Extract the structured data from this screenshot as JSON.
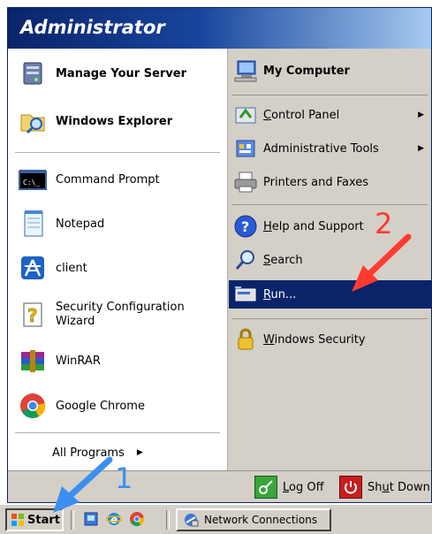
{
  "header": {
    "user": "Administrator"
  },
  "left_pinned": [
    {
      "label": "Manage Your Server",
      "icon": "server-icon"
    },
    {
      "label": "Windows Explorer",
      "icon": "folder-search-icon"
    }
  ],
  "left_recent": [
    {
      "label": "Command Prompt",
      "icon": "cmd-icon"
    },
    {
      "label": "Notepad",
      "icon": "notepad-icon"
    },
    {
      "label": "client",
      "icon": "client-icon"
    },
    {
      "label": "Security Configuration Wizard",
      "icon": "security-wizard-icon"
    },
    {
      "label": "WinRAR",
      "icon": "winrar-icon"
    },
    {
      "label": "Google Chrome",
      "icon": "chrome-icon"
    }
  ],
  "all_programs": "All Programs",
  "right_items": [
    {
      "label": "My Computer",
      "icon": "computer-icon"
    },
    {
      "label": "Control Panel",
      "icon": "control-panel-icon"
    },
    {
      "label": "Administrative Tools",
      "icon": "admin-tools-icon"
    },
    {
      "label": "Printers and Faxes",
      "icon": "printer-icon"
    },
    {
      "label": "Help and Support",
      "icon": "help-icon"
    },
    {
      "label": "Search",
      "icon": "search-icon"
    },
    {
      "label": "Run...",
      "icon": "run-icon"
    },
    {
      "label": "Windows Security",
      "icon": "lock-icon"
    }
  ],
  "bottom": {
    "logoff": "Log Off",
    "shutdown": "Shut Down"
  },
  "taskbar": {
    "start": "Start",
    "task": "Network Connections"
  },
  "annotations": {
    "step1": "1",
    "step2": "2"
  },
  "colors": {
    "header_start": "#0a246a",
    "header_end": "#a6caf0",
    "selected": "#0a246a",
    "arrow_red": "#ff3b30",
    "arrow_blue": "#3a8ff0"
  }
}
